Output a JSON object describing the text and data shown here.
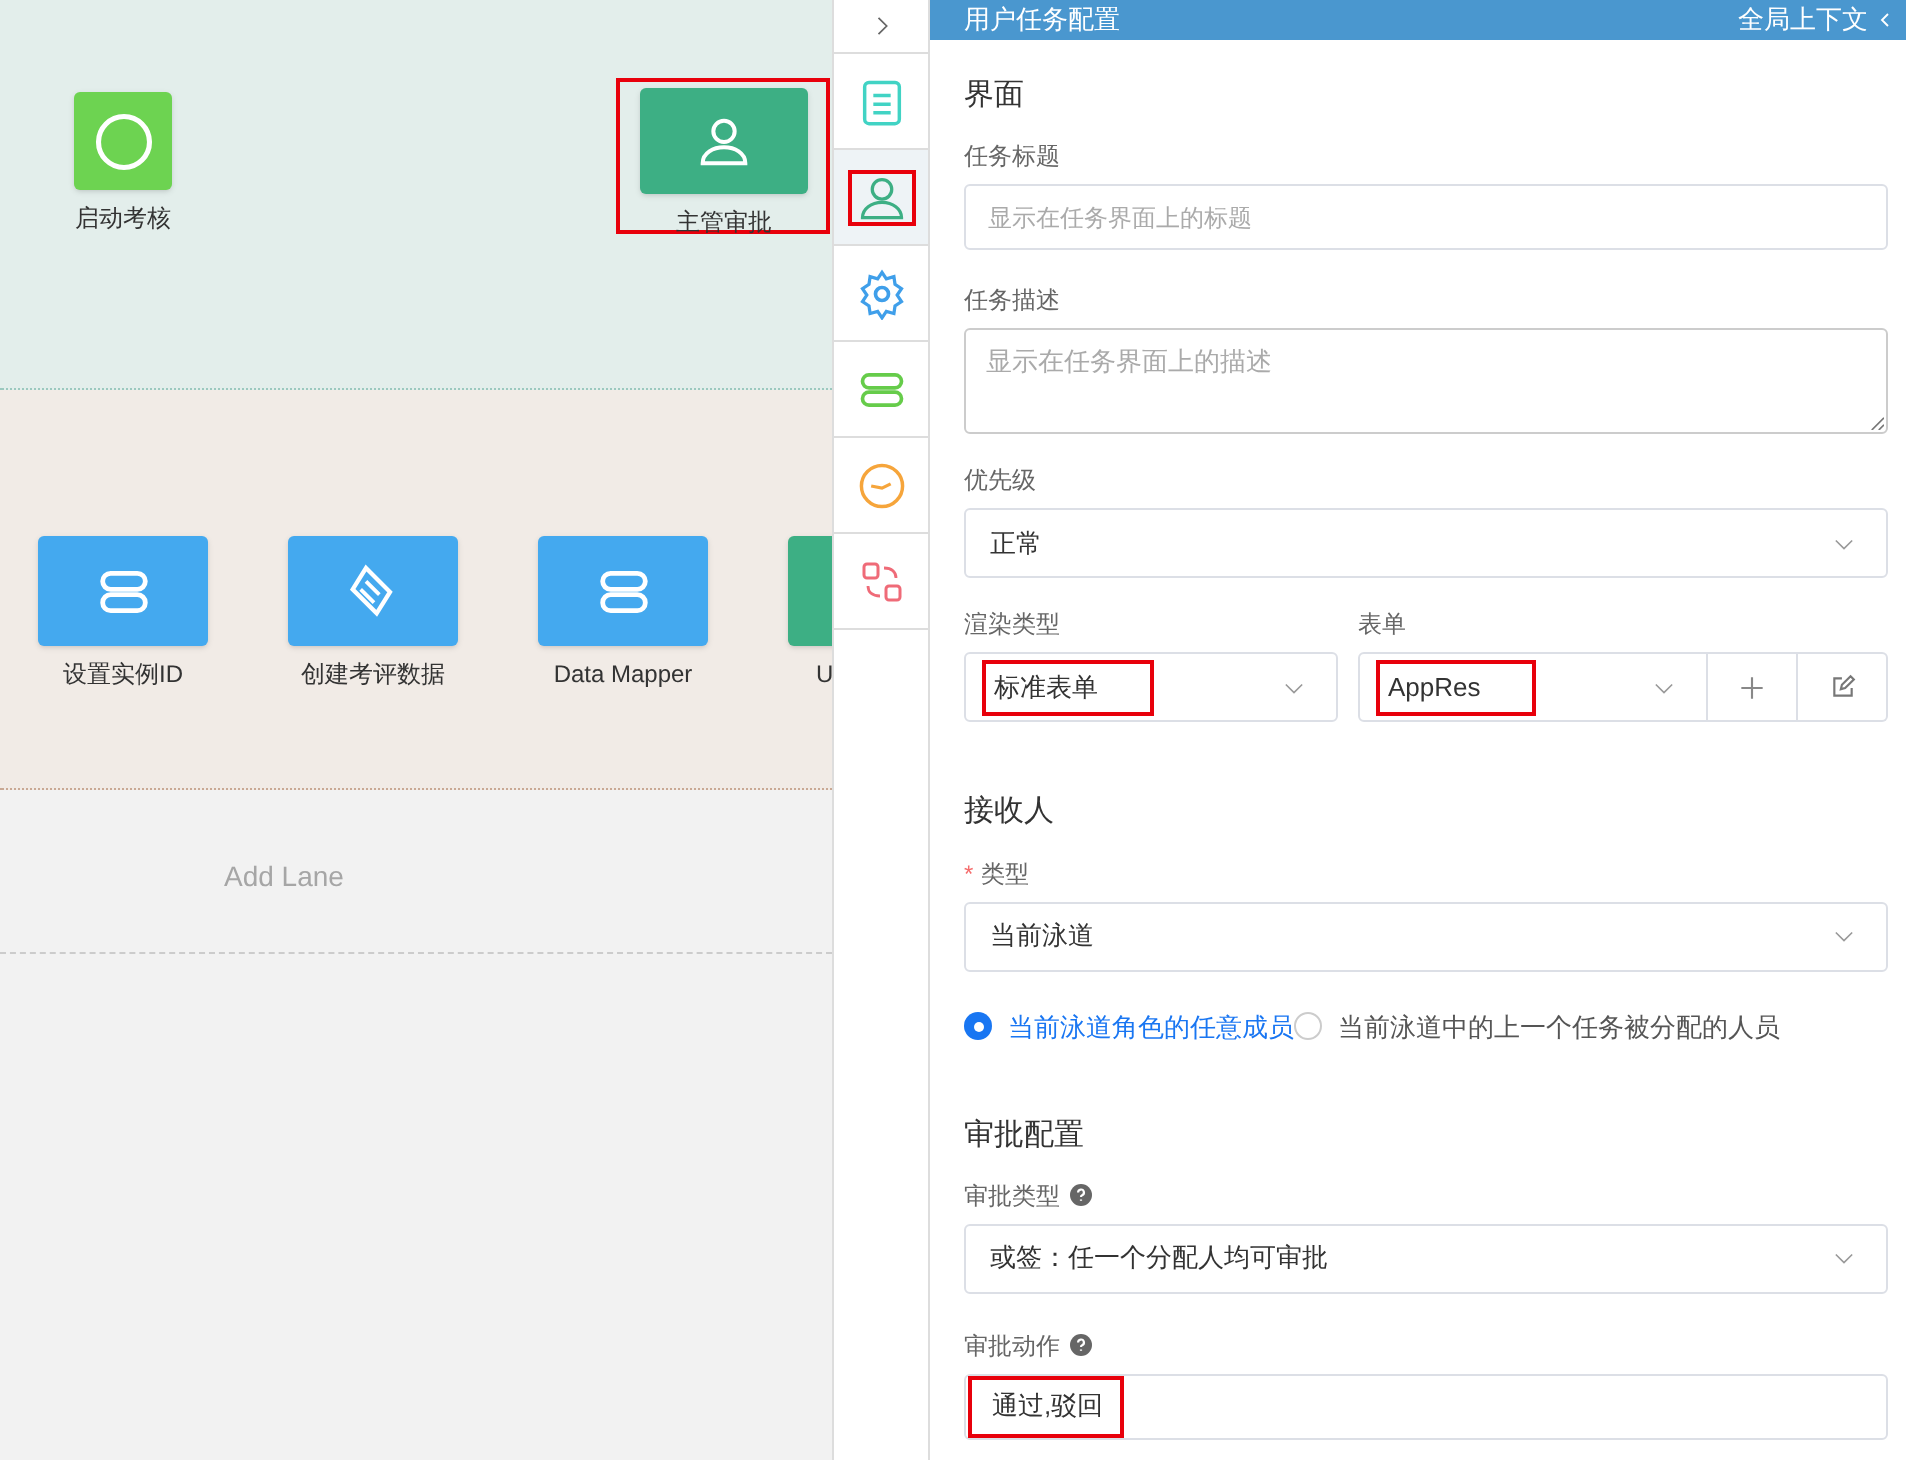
{
  "canvas": {
    "lanes": [
      {
        "kind": "lane",
        "nodes": [
          {
            "kind": "start",
            "label": "启动考核",
            "highlighted": false
          },
          {
            "kind": "user-task",
            "label": "主管审批",
            "highlighted": true
          }
        ]
      },
      {
        "kind": "lane",
        "nodes": [
          {
            "kind": "service",
            "label": "设置实例ID",
            "highlighted": false
          },
          {
            "kind": "script",
            "label": "创建考评数据",
            "highlighted": false
          },
          {
            "kind": "service",
            "label": "Data Mapper",
            "highlighted": false
          },
          {
            "kind": "user-task",
            "label": "U",
            "highlighted": false
          }
        ]
      },
      {
        "kind": "add",
        "label": "Add Lane"
      }
    ]
  },
  "toolstrip": {
    "items": [
      {
        "kind": "collapse",
        "selected": false,
        "highlighted": false
      },
      {
        "kind": "list",
        "selected": false,
        "highlighted": false
      },
      {
        "kind": "user",
        "selected": true,
        "highlighted": true
      },
      {
        "kind": "settings",
        "selected": false,
        "highlighted": false
      },
      {
        "kind": "service",
        "selected": false,
        "highlighted": false
      },
      {
        "kind": "timer",
        "selected": false,
        "highlighted": false
      },
      {
        "kind": "swap",
        "selected": false,
        "highlighted": false
      }
    ]
  },
  "panel": {
    "title": "用户任务配置",
    "context_link": "全局上下文",
    "sections": [
      {
        "title": "界面",
        "fields": [
          {
            "kind": "input",
            "label": "任务标题",
            "placeholder": "显示在任务界面上的标题"
          },
          {
            "kind": "textarea",
            "label": "任务描述",
            "placeholder": "显示在任务界面上的描述"
          },
          {
            "kind": "select",
            "label": "优先级",
            "value": "正常"
          },
          {
            "kind": "select-pair",
            "items": [
              {
                "label": "渲染类型",
                "value": "标准表单",
                "highlighted": true
              },
              {
                "label": "表单",
                "value": "AppRes",
                "highlighted": true
              }
            ]
          }
        ]
      },
      {
        "title": "接收人",
        "fields": [
          {
            "kind": "select",
            "label": "类型",
            "required_mark": "*",
            "value": "当前泳道"
          },
          {
            "kind": "radio-group",
            "options": [
              {
                "label": "当前泳道角色的任意成员",
                "selected": true
              },
              {
                "label": "当前泳道中的上一个任务被分配的人员",
                "selected": false
              }
            ]
          }
        ]
      },
      {
        "title": "审批配置",
        "fields": [
          {
            "kind": "select",
            "label": "审批类型",
            "help": true,
            "value": "或签：任一个分配人均可审批"
          },
          {
            "kind": "input",
            "label": "审批动作",
            "help": true,
            "value": "通过,驳回",
            "highlighted": true
          }
        ]
      }
    ]
  }
}
